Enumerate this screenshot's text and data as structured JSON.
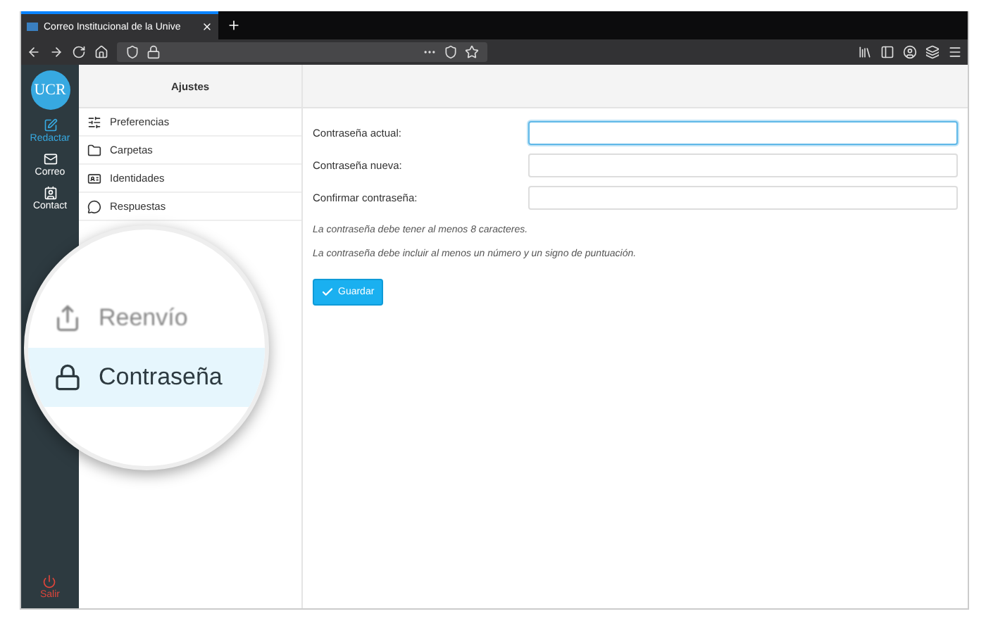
{
  "browser": {
    "tab_title": "Correo Institucional de la Unive"
  },
  "rail": {
    "logo": "UCR",
    "items": [
      {
        "label": "Redactar",
        "selected": true,
        "kind": "compose"
      },
      {
        "label": "Correo",
        "selected": false,
        "kind": "mail"
      },
      {
        "label": "Contact",
        "selected": false,
        "kind": "contacts"
      }
    ],
    "logout": "Salir"
  },
  "settings": {
    "title": "Ajustes",
    "items": [
      {
        "label": "Preferencias",
        "kind": "sliders"
      },
      {
        "label": "Carpetas",
        "kind": "folder"
      },
      {
        "label": "Identidades",
        "kind": "card"
      },
      {
        "label": "Respuestas",
        "kind": "chat"
      }
    ]
  },
  "magnifier": {
    "items": [
      {
        "label": "Reenvío",
        "kind": "forward",
        "selected": false
      },
      {
        "label": "Contraseña",
        "kind": "lock",
        "selected": true
      }
    ]
  },
  "form": {
    "fields": [
      {
        "label": "Contraseña actual:",
        "focused": true
      },
      {
        "label": "Contraseña nueva:",
        "focused": false
      },
      {
        "label": "Confirmar contraseña:",
        "focused": false
      }
    ],
    "hints": [
      "La contraseña debe tener al menos 8 caracteres.",
      "La contraseña debe incluir al menos un número y un signo de puntuación."
    ],
    "save_button": "Guardar"
  }
}
